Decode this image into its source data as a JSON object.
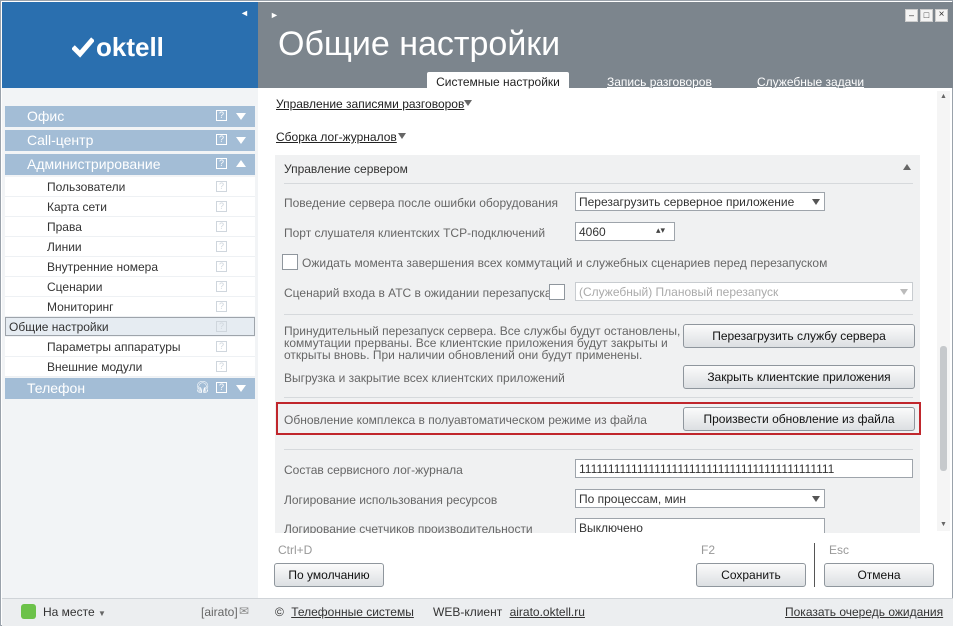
{
  "brand": {
    "logo_text": "oktell"
  },
  "header": {
    "title": "Общие настройки"
  },
  "tabs": [
    {
      "label": "Системные настройки",
      "active": true
    },
    {
      "label": "Запись разговоров",
      "active": false
    },
    {
      "label": "Служебные задачи",
      "active": false
    }
  ],
  "nav": {
    "office": "Офис",
    "callcenter": "Call-центр",
    "admin": "Администрирование",
    "items": [
      "Пользователи",
      "Карта сети",
      "Права",
      "Линии",
      "Внутренние номера",
      "Сценарии",
      "Мониторинг",
      "Общие настройки",
      "Параметры аппаратуры",
      "Внешние модули"
    ],
    "phone": "Телефон"
  },
  "content": {
    "link1": "Управление записями разговоров",
    "link2": "Сборка лог-журналов",
    "section_title": "Управление сервером",
    "row1_label": "Поведение сервера после ошибки оборудования",
    "row1_value": "Перезагрузить серверное приложение",
    "row2_label": "Порт слушателя клиентских TCP-подключений",
    "row2_value": "4060",
    "row3_label": "Ожидать момента завершения всех коммутаций и служебных сценариев перед перезапуском",
    "row4_label": "Сценарий входа в АТС в ожидании перезапуска",
    "row4_value": "(Служебный) Плановый перезапуск",
    "restart_desc_l1": "Принудительный перезапуск сервера. Все службы будут остановлены,",
    "restart_desc_l2": "коммутации прерваны. Все клиентские приложения будут закрыты и",
    "restart_desc_l3": "открыты вновь. При наличии обновлений они будут применены.",
    "restart_button": "Перезагрузить службу сервера",
    "close_label": "Выгрузка и закрытие всех клиентских приложений",
    "close_button": "Закрыть клиентские приложения",
    "update_label": "Обновление комплекса в полуавтоматическом режиме из файла",
    "update_button": "Произвести обновление из файла",
    "log_label": "Состав сервисного лог-журнала",
    "log_value": "11111111111111111111111111111111111111111111",
    "res_label": "Логирование использования ресурсов",
    "res_value": "По процессам, мин",
    "perf_label": "Логирование счетчиков производительности",
    "perf_value": "Выключено"
  },
  "actions": {
    "default_shortcut": "Ctrl+D",
    "default_button": "По умолчанию",
    "save_shortcut": "F2",
    "save_button": "Сохранить",
    "cancel_shortcut": "Esc",
    "cancel_button": "Отмена"
  },
  "footer": {
    "status": "На месте",
    "user": "[airato]",
    "copyright": "©",
    "company": "Телефонные системы",
    "web_label": "WEB-клиент",
    "web_link": "airato.oktell.ru",
    "queue_link": "Показать очередь ожидания"
  },
  "colors": {
    "logo_bg": "#2a6faf",
    "header_bg": "#7c858d",
    "nav_head": "#a3bdd6",
    "highlight_border": "#c0262c",
    "status_green": "#6cc24a"
  }
}
